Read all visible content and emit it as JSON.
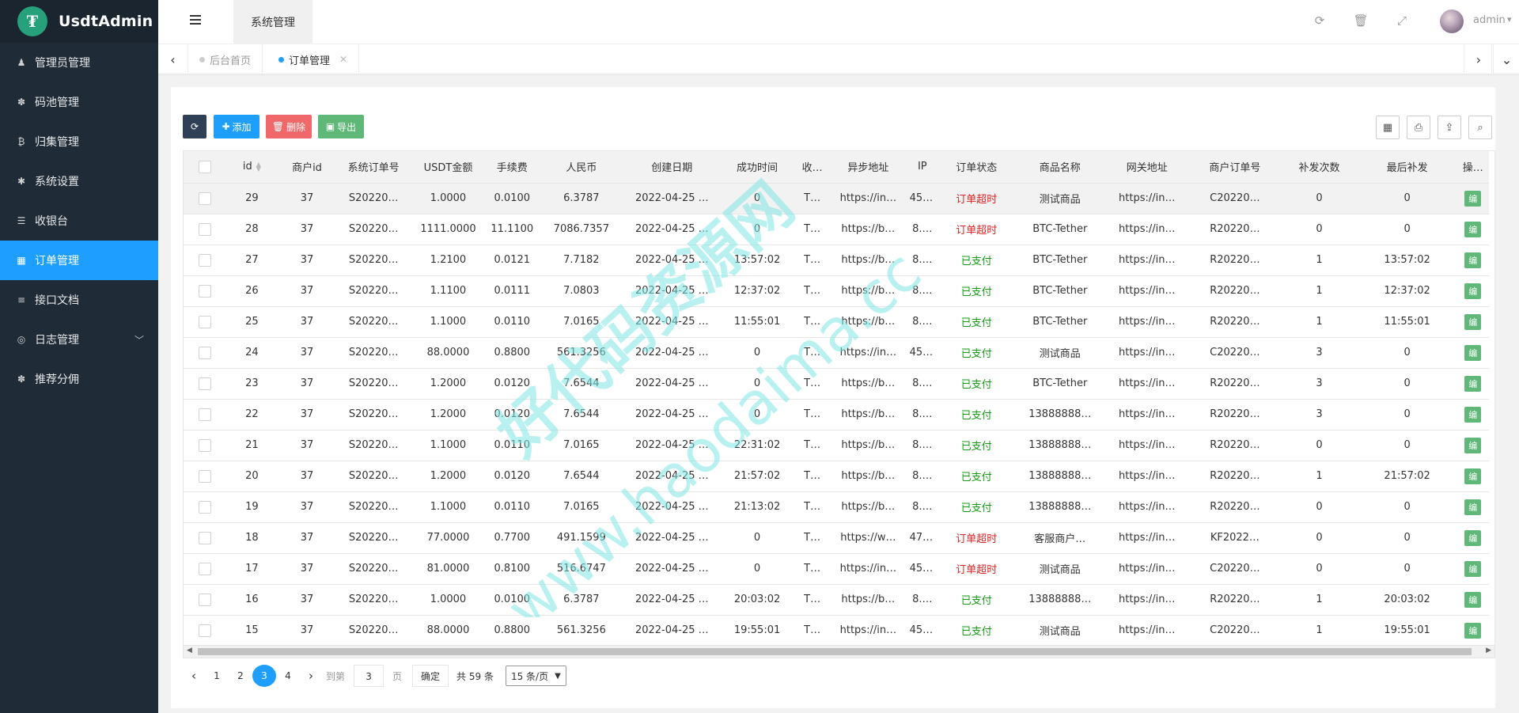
{
  "brand": {
    "name": "UsdtAdmin",
    "logo_glyph": "₮"
  },
  "sidebar": {
    "items": [
      {
        "label": "管理员管理",
        "icon": "user-icon",
        "glyph": "♟"
      },
      {
        "label": "码池管理",
        "icon": "android-icon",
        "glyph": "✽"
      },
      {
        "label": "归集管理",
        "icon": "bitcoin-icon",
        "glyph": "₿"
      },
      {
        "label": "系统设置",
        "icon": "asterisk-icon",
        "glyph": "✱"
      },
      {
        "label": "收银台",
        "icon": "list-icon",
        "glyph": "☰"
      },
      {
        "label": "订单管理",
        "icon": "calculator-icon",
        "glyph": "▦",
        "active": true
      },
      {
        "label": "接口文档",
        "icon": "align-left-icon",
        "glyph": "≡"
      },
      {
        "label": "日志管理",
        "icon": "dashboard-icon",
        "glyph": "◎",
        "expandable": true
      },
      {
        "label": "推荐分佣",
        "icon": "android-icon",
        "glyph": "✽"
      }
    ]
  },
  "header": {
    "tab_label": "系统管理",
    "user_name": "admin",
    "icons": [
      "refresh-icon",
      "trash-icon",
      "fullscreen-icon"
    ]
  },
  "tabs": [
    {
      "label": "后台首页",
      "active": false
    },
    {
      "label": "订单管理",
      "active": true,
      "closable": true
    }
  ],
  "toolbar": {
    "refresh_label": "",
    "add_label": "添加",
    "delete_label": "删除",
    "export_label": "导出",
    "right_icons": [
      "columns-icon",
      "print-icon",
      "export-icon",
      "search-icon"
    ]
  },
  "table": {
    "columns": [
      "id",
      "商户id",
      "系统订单号",
      "USDT金额",
      "手续费",
      "人民币",
      "创建日期",
      "成功时间",
      "收…",
      "异步地址",
      "IP",
      "订单状态",
      "商品名称",
      "网关地址",
      "商户订单号",
      "补发次数",
      "最后补发",
      "操…"
    ],
    "rows": [
      [
        "29",
        "37",
        "S20220…",
        "1.0000",
        "0.0100",
        "6.3787",
        "2022-04-25 …",
        "0",
        "T…",
        "https://in…",
        "45.…",
        "订单超时",
        "测试商品",
        "https://in…",
        "C20220…",
        "0",
        "0",
        "编"
      ],
      [
        "28",
        "37",
        "S20220…",
        "1111.0000",
        "11.1100",
        "7086.7357",
        "2022-04-25 …",
        "0",
        "T…",
        "https://b…",
        "8.…",
        "订单超时",
        "BTC-Tether",
        "https://in…",
        "R20220…",
        "0",
        "0",
        "编"
      ],
      [
        "27",
        "37",
        "S20220…",
        "1.2100",
        "0.0121",
        "7.7182",
        "2022-04-25 …",
        "13:57:02",
        "T…",
        "https://b…",
        "8.…",
        "已支付",
        "BTC-Tether",
        "https://in…",
        "R20220…",
        "1",
        "13:57:02",
        "编"
      ],
      [
        "26",
        "37",
        "S20220…",
        "1.1100",
        "0.0111",
        "7.0803",
        "2022-04-25 …",
        "12:37:02",
        "T…",
        "https://b…",
        "8.…",
        "已支付",
        "BTC-Tether",
        "https://in…",
        "R20220…",
        "1",
        "12:37:02",
        "编"
      ],
      [
        "25",
        "37",
        "S20220…",
        "1.1000",
        "0.0110",
        "7.0165",
        "2022-04-25 …",
        "11:55:01",
        "T…",
        "https://b…",
        "8.…",
        "已支付",
        "BTC-Tether",
        "https://in…",
        "R20220…",
        "1",
        "11:55:01",
        "编"
      ],
      [
        "24",
        "37",
        "S20220…",
        "88.0000",
        "0.8800",
        "561.3256",
        "2022-04-25 …",
        "0",
        "T…",
        "https://in…",
        "45.…",
        "已支付",
        "测试商品",
        "https://in…",
        "C20220…",
        "3",
        "0",
        "编"
      ],
      [
        "23",
        "37",
        "S20220…",
        "1.2000",
        "0.0120",
        "7.6544",
        "2022-04-25 …",
        "0",
        "T…",
        "https://b…",
        "8.…",
        "已支付",
        "BTC-Tether",
        "https://in…",
        "R20220…",
        "3",
        "0",
        "编"
      ],
      [
        "22",
        "37",
        "S20220…",
        "1.2000",
        "0.0120",
        "7.6544",
        "2022-04-25 …",
        "0",
        "T…",
        "https://b…",
        "8.…",
        "已支付",
        "13888888…",
        "https://in…",
        "R20220…",
        "3",
        "0",
        "编"
      ],
      [
        "21",
        "37",
        "S20220…",
        "1.1000",
        "0.0110",
        "7.0165",
        "2022-04-25 …",
        "22:31:02",
        "T…",
        "https://b…",
        "8.…",
        "已支付",
        "13888888…",
        "https://in…",
        "R20220…",
        "0",
        "0",
        "编"
      ],
      [
        "20",
        "37",
        "S20220…",
        "1.2000",
        "0.0120",
        "7.6544",
        "2022-04-25 …",
        "21:57:02",
        "T…",
        "https://b…",
        "8.…",
        "已支付",
        "13888888…",
        "https://in…",
        "R20220…",
        "1",
        "21:57:02",
        "编"
      ],
      [
        "19",
        "37",
        "S20220…",
        "1.1000",
        "0.0110",
        "7.0165",
        "2022-04-25 …",
        "21:13:02",
        "T…",
        "https://b…",
        "8.…",
        "已支付",
        "13888888…",
        "https://in…",
        "R20220…",
        "0",
        "0",
        "编"
      ],
      [
        "18",
        "37",
        "S20220…",
        "77.0000",
        "0.7700",
        "491.1599",
        "2022-04-25 …",
        "0",
        "T…",
        "https://w…",
        "47.…",
        "订单超时",
        "客服商户…",
        "https://in…",
        "KF2022…",
        "0",
        "0",
        "编"
      ],
      [
        "17",
        "37",
        "S20220…",
        "81.0000",
        "0.8100",
        "516.6747",
        "2022-04-25 …",
        "0",
        "T…",
        "https://in…",
        "45.…",
        "订单超时",
        "测试商品",
        "https://in…",
        "C20220…",
        "0",
        "0",
        "编"
      ],
      [
        "16",
        "37",
        "S20220…",
        "1.0000",
        "0.0100",
        "6.3787",
        "2022-04-25 …",
        "20:03:02",
        "T…",
        "https://b…",
        "8.…",
        "已支付",
        "13888888…",
        "https://in…",
        "R20220…",
        "1",
        "20:03:02",
        "编"
      ],
      [
        "15",
        "37",
        "S20220…",
        "88.0000",
        "0.8800",
        "561.3256",
        "2022-04-25 …",
        "19:55:01",
        "T…",
        "https://in…",
        "45.…",
        "已支付",
        "测试商品",
        "https://in…",
        "C20220…",
        "1",
        "19:55:01",
        "编"
      ]
    ],
    "status_colors": {
      "订单超时": "#e02222",
      "已支付": "#139b13"
    }
  },
  "pagination": {
    "pages": [
      "1",
      "2",
      "3",
      "4"
    ],
    "current": "3",
    "goto_prefix": "到第",
    "goto_value": "3",
    "goto_suffix": "页",
    "confirm_label": "确定",
    "total_label": "共 59 条",
    "page_size_label": "15 条/页"
  },
  "watermark": {
    "line1": "好代码资源网",
    "line2": "www.haodaima.cc",
    "color": "#7fe6e6"
  },
  "colors": {
    "sidebar_bg": "#1f2b37",
    "accent": "#1e9fff",
    "add": "#1e9fff",
    "delete": "#ff5722",
    "export": "#5fb878"
  }
}
